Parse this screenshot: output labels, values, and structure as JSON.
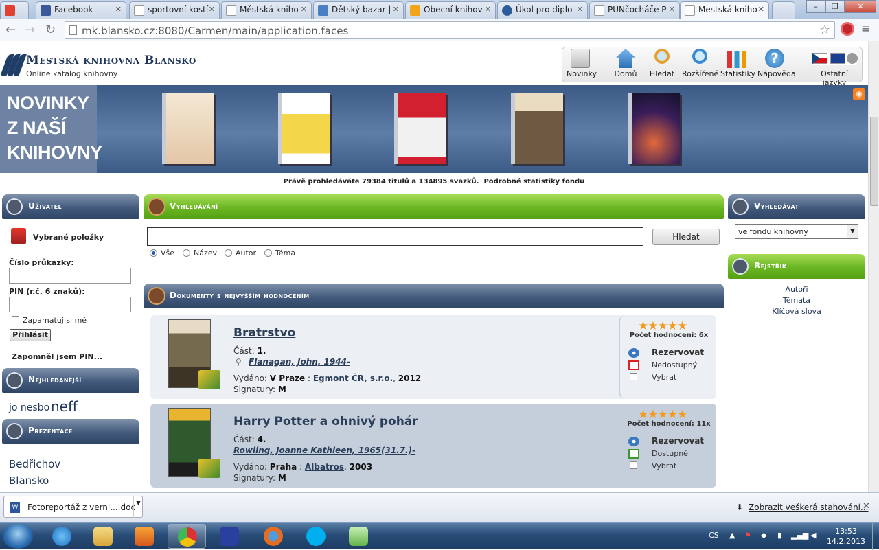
{
  "tabs": [
    {
      "label": "",
      "color": "#e04132",
      "icon": "gmail-icon"
    },
    {
      "label": "Facebook",
      "color": "#3b5998",
      "icon": "facebook-icon"
    },
    {
      "label": "sportovní kostí",
      "color": "#ffffff",
      "icon": "document-icon"
    },
    {
      "label": "Městská kniho",
      "color": "#ffffff",
      "icon": "document-icon"
    },
    {
      "label": "Dětský bazar |",
      "color": "#4a7fc1",
      "icon": "bazar-icon"
    },
    {
      "label": "Obecní knihov",
      "color": "#f2a51a",
      "icon": "owl-icon"
    },
    {
      "label": "Úkol pro diplo",
      "color": "#2b5d9b",
      "icon": "uk-icon"
    },
    {
      "label": "PUNčocháče P",
      "color": "#ffffff",
      "icon": "document-icon"
    },
    {
      "label": "Mestská kniho",
      "color": "#ffffff",
      "icon": "document-icon"
    }
  ],
  "browser": {
    "url": "mk.blansko.cz:8080/Carmen/main/application.faces"
  },
  "site": {
    "title": "Mestská knihovna Blansko",
    "subtitle": "Online katalog knihovny"
  },
  "topnav": [
    {
      "label": "Novinky",
      "icon": "news-icon"
    },
    {
      "label": "Domů",
      "icon": "home-icon"
    },
    {
      "label": "Hledat",
      "icon": "search-icon"
    },
    {
      "label": "Rozšířené",
      "icon": "advanced-search-icon"
    },
    {
      "label": "Statistiky",
      "icon": "stats-icon"
    },
    {
      "label": "Nápověda",
      "icon": "help-icon"
    },
    {
      "label": "Ostatní jazyky",
      "icon": "flags-icon"
    }
  ],
  "banner": {
    "line1": "NOVINKY",
    "line2": "Z NAŠÍ",
    "line3": "KNIHOVNY"
  },
  "stats_text": "Právě prohledáváte 79384 titulů a 134895 svazků.",
  "stats_link": "Podrobné statistiky fondu",
  "user": {
    "header": "Uživatel",
    "selected": "Vybrané položky",
    "card_label": "Číslo průkazky:",
    "pin_label": "PIN (r.č. 6 znaků):",
    "remember": "Zapamatuj si mě",
    "login": "Přihlásit",
    "forgot": "Zapomněl jsem PIN..."
  },
  "popular": {
    "header": "Nejhledanější",
    "word1": "jo nesbo",
    "word2": "neff"
  },
  "presentation": {
    "header": "Prezentace",
    "item1": "Bedřichov",
    "item2": "Blansko"
  },
  "search": {
    "header": "Vyhledávání",
    "button": "Hledat",
    "value": "",
    "options": [
      "Vše",
      "Název",
      "Autor",
      "Téma"
    ],
    "selected": "Vše"
  },
  "top_rated_header": "Dokumenty s nejvyšším hodnocením",
  "results": [
    {
      "title": "Bratrstvo",
      "part_label": "Část:",
      "part": "1.",
      "author": "Flanagan, John, 1944-",
      "publ_label": "Vydáno:",
      "place": "V Praze",
      "publisher": "Egmont ČR, s.r.o.",
      "year": "2012",
      "sig_label": "Signatury:",
      "signature": "M",
      "stars": 5,
      "rating_count": "Počet hodnocení: 6x",
      "reserve": "Rezervovat",
      "availability": "Nedostupný",
      "available": false,
      "select": "Vybrat"
    },
    {
      "title": "Harry Potter a ohnivý pohár",
      "part_label": "Část:",
      "part": "4.",
      "author": "Rowling, Joanne Kathleen, 1965(31.7.)-",
      "publ_label": "Vydáno:",
      "place": "Praha",
      "publisher": "Albatros",
      "year": "2003",
      "sig_label": "Signatury:",
      "signature": "M",
      "stars": 5,
      "rating_count": "Počet hodnocení: 11x",
      "reserve": "Rezervovat",
      "availability": "Dostupné",
      "available": true,
      "select": "Vybrat"
    }
  ],
  "right": {
    "search_header": "Vyhledávat",
    "scope": "ve fondu knihovny",
    "index_header": "Rejstřík",
    "index_items": [
      "Autoři",
      "Témata",
      "Klíčová slova"
    ]
  },
  "downloads": {
    "file": "Fotoreportáž z verni....doc",
    "show_all": "Zobrazit veškerá stahování..."
  },
  "taskbar": {
    "lang": "CS",
    "time": "13:53",
    "date": "14.2.2013"
  }
}
